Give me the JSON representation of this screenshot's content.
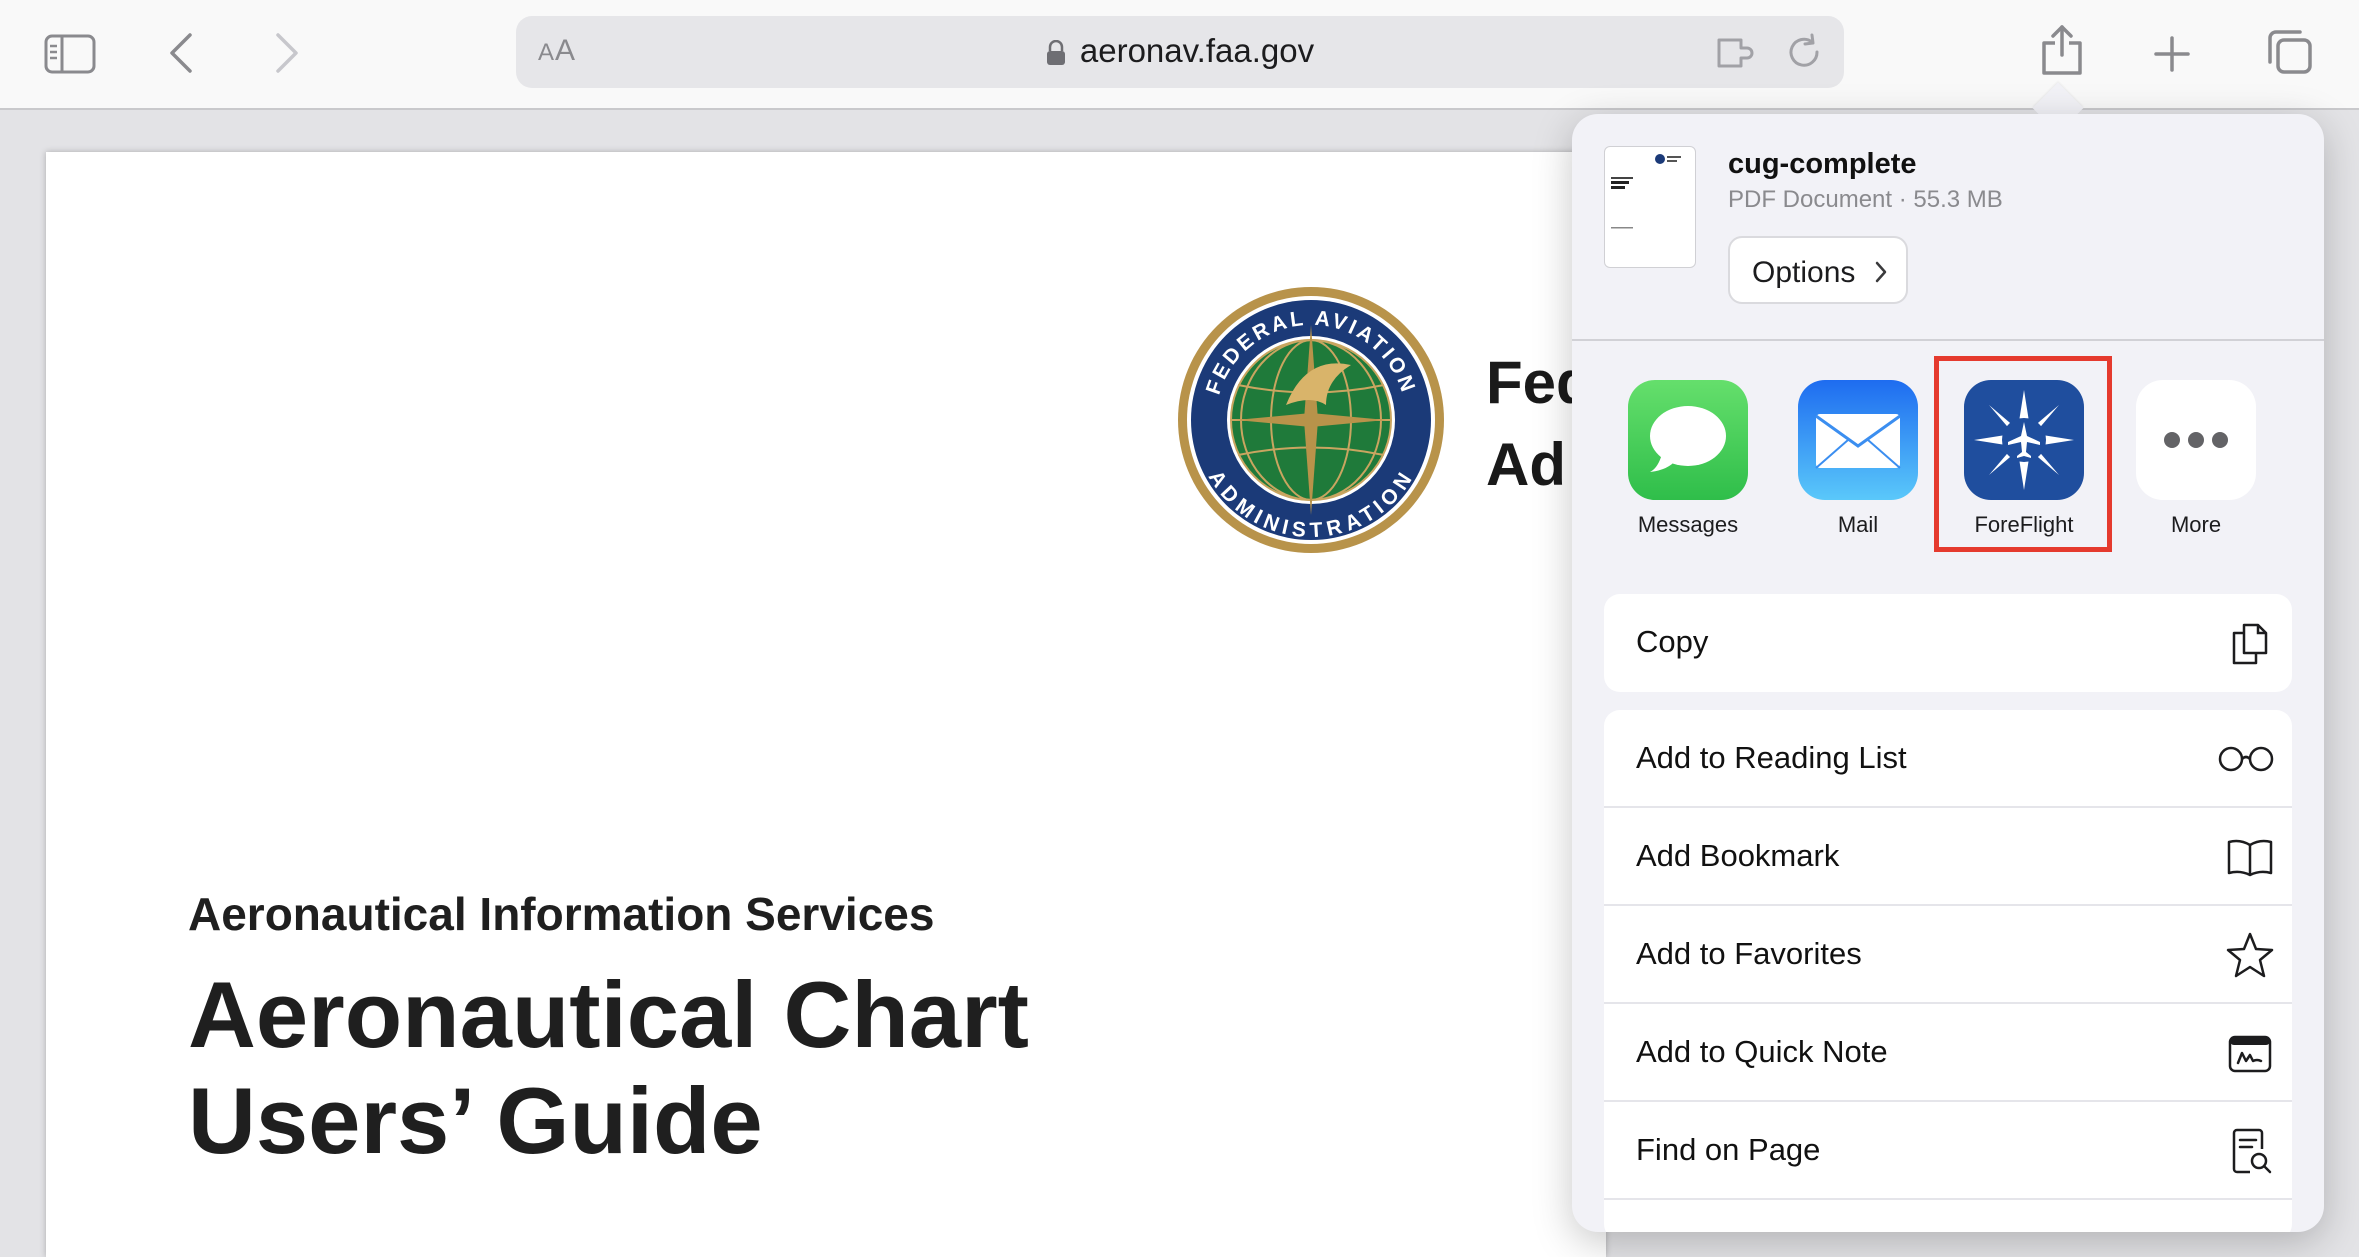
{
  "toolbar": {
    "reader_text_small": "A",
    "reader_text_large": "A",
    "url": "aeronav.faa.gov",
    "icons": [
      "sidebar-icon",
      "back-icon",
      "forward-icon",
      "extension-icon",
      "reload-icon",
      "share-icon",
      "new-tab-icon",
      "tab-overview-icon"
    ]
  },
  "document": {
    "agency_line1": "Fed",
    "agency_line2": "Ad",
    "subtitle": "Aeronautical Information Services",
    "title_line1": "Aeronautical Chart",
    "title_line2": "Users’ Guide",
    "seal": {
      "top_text": "FEDERAL AVIATION",
      "bottom_text": "ADMINISTRATION"
    }
  },
  "share_sheet": {
    "file_name": "cug-complete",
    "file_meta": "PDF Document · 55.3 MB",
    "options_label": "Options",
    "apps": [
      {
        "label": "Messages",
        "icon": "messages-icon"
      },
      {
        "label": "Mail",
        "icon": "mail-icon"
      },
      {
        "label": "ForeFlight",
        "icon": "foreflight-icon"
      },
      {
        "label": "More",
        "icon": "more-icon"
      }
    ],
    "copy_label": "Copy",
    "actions": [
      {
        "label": "Add to Reading List",
        "icon": "glasses-icon"
      },
      {
        "label": "Add Bookmark",
        "icon": "book-icon"
      },
      {
        "label": "Add to Favorites",
        "icon": "star-icon"
      },
      {
        "label": "Add to Quick Note",
        "icon": "quick-note-icon"
      },
      {
        "label": "Find on Page",
        "icon": "find-on-page-icon"
      }
    ]
  },
  "colors": {
    "highlight": "#e53a2e",
    "foreflight": "#1f4e9e",
    "messages": "#34c759",
    "mail": "#1e90ff",
    "seal_blue": "#1b3a78",
    "seal_gold": "#b8934a",
    "seal_green": "#1f7a3a"
  }
}
